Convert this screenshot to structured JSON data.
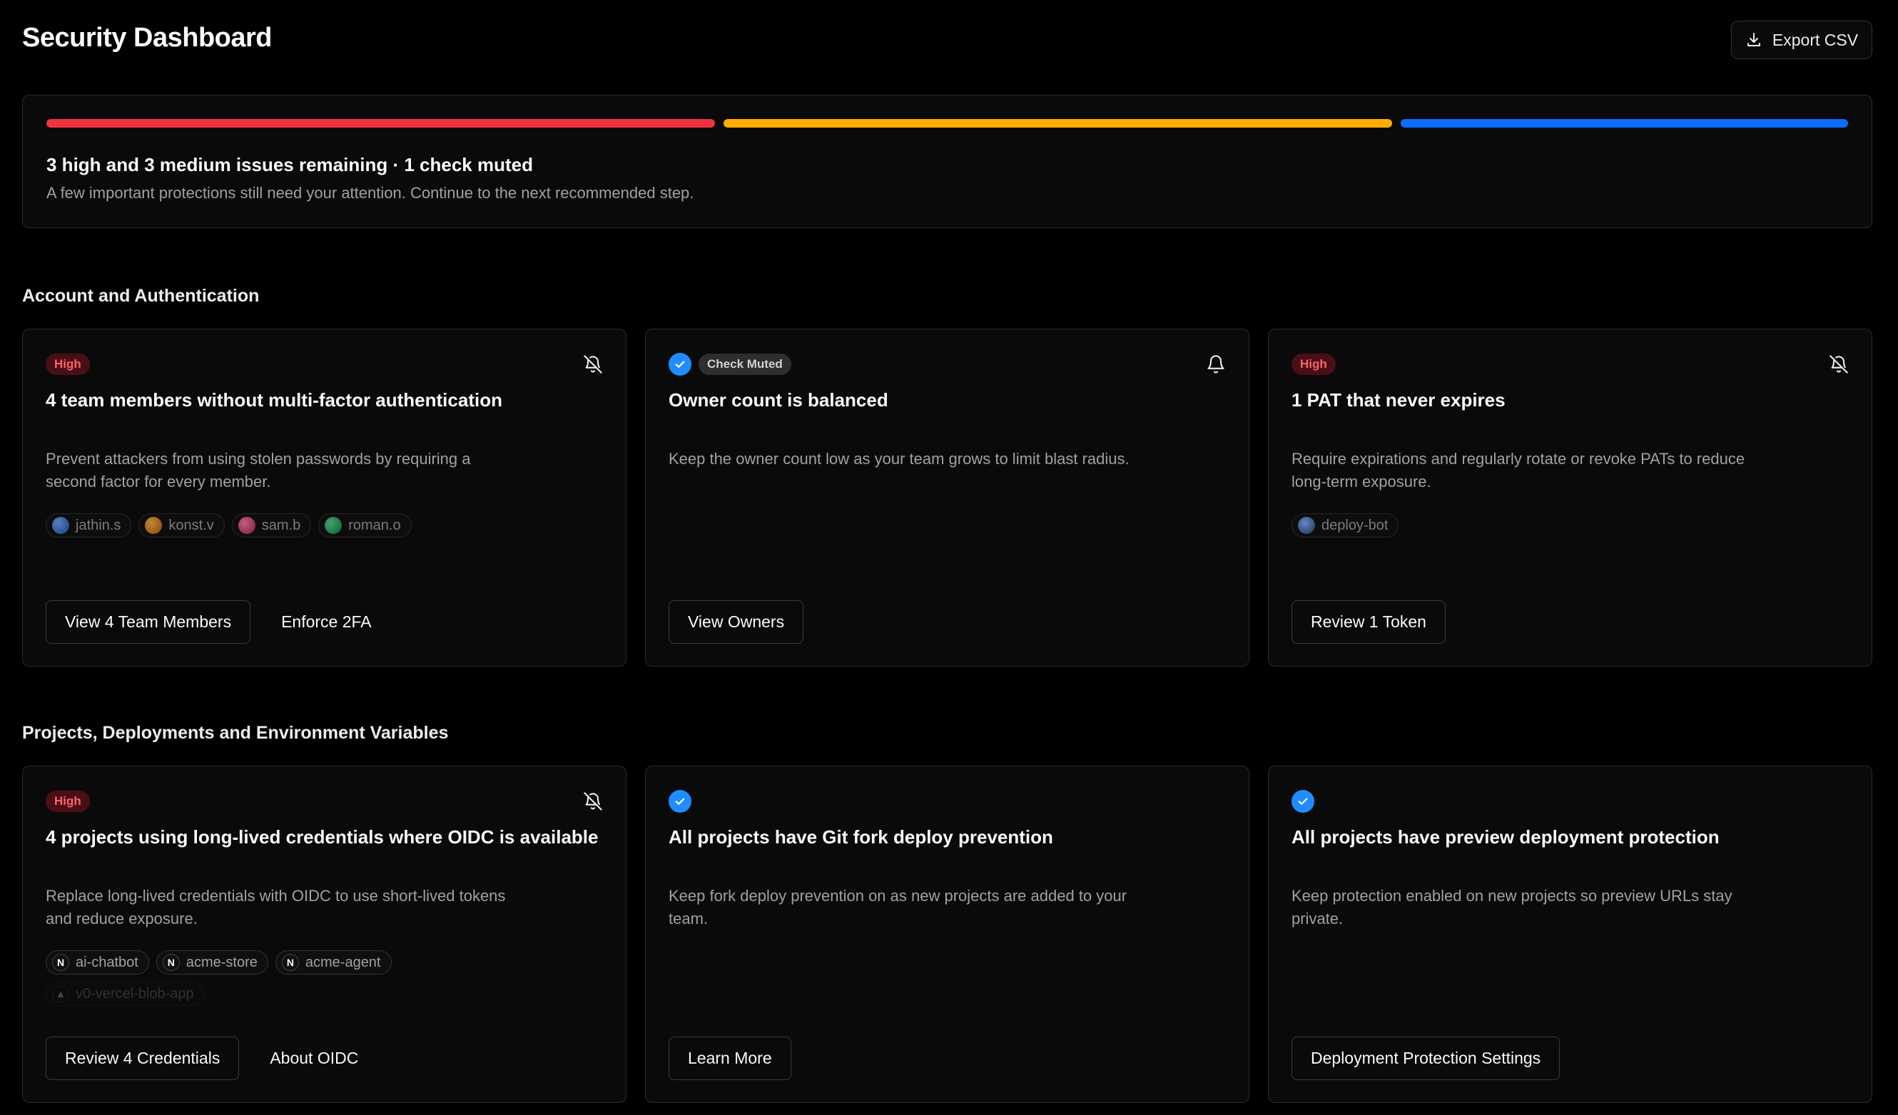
{
  "header": {
    "title": "Security Dashboard",
    "export_label": "Export CSV"
  },
  "summary": {
    "severity_segments": [
      {
        "level": "high",
        "color": "#ef3340"
      },
      {
        "level": "medium",
        "color": "#ffae00"
      },
      {
        "level": "muted",
        "color": "#0a6cff"
      }
    ],
    "title": "3 high and 3 medium issues remaining · 1 check muted",
    "subtitle": "A few important protections still need your attention. Continue to the next recommended step."
  },
  "sections": [
    {
      "title": "Account and Authentication",
      "cards": [
        {
          "badge": "High",
          "title": "4 team members without multi-factor authentication",
          "description": "Prevent attackers from using stolen passwords by requiring a second factor for every member.",
          "chips": [
            "jathin.s",
            "konst.v",
            "sam.b",
            "roman.o"
          ],
          "primary_action": "View 4 Team Members",
          "secondary_action": "Enforce 2FA",
          "bell_icon": "bell-off-icon"
        },
        {
          "badge": "Check Muted",
          "title": "Owner count is balanced",
          "description": "Keep the owner count low as your team grows to limit blast radius.",
          "primary_action": "View Owners",
          "bell_icon": "bell-icon"
        },
        {
          "badge": "High",
          "title": "1 PAT that never expires",
          "description": "Require expirations and regularly rotate or revoke PATs to reduce long-term exposure.",
          "chips": [
            "deploy-bot"
          ],
          "primary_action": "Review 1 Token",
          "bell_icon": "bell-off-icon"
        }
      ]
    },
    {
      "title": "Projects, Deployments and Environment Variables",
      "cards": [
        {
          "badge": "High",
          "title": "4 projects using long-lived credentials where OIDC is available",
          "description": "Replace long-lived credentials with OIDC to use short-lived tokens and reduce exposure.",
          "chips": [
            "ai-chatbot",
            "acme-store",
            "acme-agent",
            "v0-vercel-blob-app"
          ],
          "primary_action": "Review 4 Credentials",
          "secondary_action": "About OIDC",
          "bell_icon": "bell-off-icon"
        },
        {
          "title": "All projects have Git fork deploy prevention",
          "description": "Keep fork deploy prevention on as new projects are added to your team.",
          "primary_action": "Learn More"
        },
        {
          "title": "All projects have preview deployment protection",
          "description": "Keep protection enabled on new projects so preview URLs stay private.",
          "primary_action": "Deployment Protection Settings"
        }
      ]
    }
  ]
}
